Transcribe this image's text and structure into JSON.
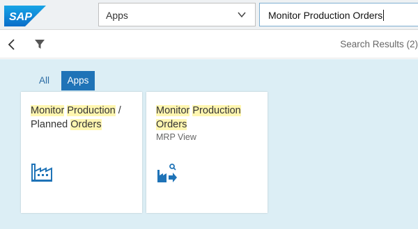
{
  "header": {
    "logo_text": "SAP",
    "scope_value": "Apps",
    "search_value": "Monitor Production Orders"
  },
  "subheader": {
    "result_count": "Search Results (2)"
  },
  "tabs": [
    {
      "label": "All",
      "selected": false
    },
    {
      "label": "Apps",
      "selected": true
    }
  ],
  "tiles": [
    {
      "title_parts": [
        "Monitor",
        " ",
        "Production",
        " /",
        "Planned",
        " ",
        "Orders"
      ],
      "subtitle": "",
      "icon": "factory-icon"
    },
    {
      "title_parts": [
        "Monitor",
        " ",
        "Production",
        "Orders"
      ],
      "subtitle": "MRP View",
      "icon": "factory-search-arrow-icon"
    }
  ],
  "colors": {
    "accent": "#1f73b7",
    "highlight": "#fff6b0",
    "content_bg": "#dceef5",
    "header_bg": "#eef1f3"
  }
}
